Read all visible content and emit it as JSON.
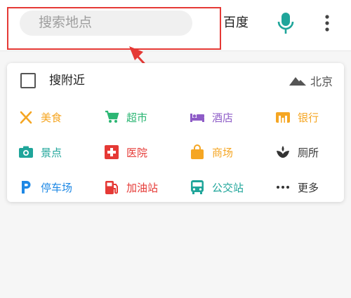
{
  "search": {
    "placeholder": "搜索地点"
  },
  "header": {
    "engine_label": "百度"
  },
  "nearby": {
    "label": "搜附近",
    "city": "北京"
  },
  "categories": [
    {
      "label": "美食",
      "color": "#f5a623",
      "icon": "fork-knife-icon"
    },
    {
      "label": "超市",
      "color": "#2bb673",
      "icon": "cart-icon"
    },
    {
      "label": "酒店",
      "color": "#8e5cc7",
      "icon": "bed-icon"
    },
    {
      "label": "银行",
      "color": "#f5a623",
      "icon": "bank-icon"
    },
    {
      "label": "景点",
      "color": "#1fa59a",
      "icon": "camera-icon"
    },
    {
      "label": "医院",
      "color": "#e53935",
      "icon": "first-aid-icon"
    },
    {
      "label": "商场",
      "color": "#f5a623",
      "icon": "shopping-bag-icon"
    },
    {
      "label": "厕所",
      "color": "#333333",
      "icon": "toilet-icon"
    },
    {
      "label": "停车场",
      "color": "#1e88e5",
      "icon": "parking-icon"
    },
    {
      "label": "加油站",
      "color": "#e53935",
      "icon": "gas-station-icon"
    },
    {
      "label": "公交站",
      "color": "#1fa59a",
      "icon": "bus-icon"
    },
    {
      "label": "更多",
      "color": "#333333",
      "icon": "more-dots-icon"
    }
  ]
}
